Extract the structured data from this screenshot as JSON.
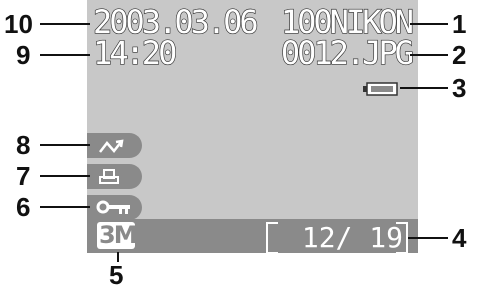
{
  "screen": {
    "date": "2003.03.06",
    "time": "14:20",
    "folder": "100NIKON",
    "file": "0012.JPG",
    "image_size": "3M",
    "frame_current": "12",
    "frame_total": "19",
    "frame_display": "12/  19"
  },
  "callouts": [
    "1",
    "2",
    "3",
    "4",
    "5",
    "6",
    "7",
    "8",
    "9",
    "10"
  ],
  "icons": [
    "transfer-icon",
    "print-icon",
    "protect-key-icon",
    "battery-icon"
  ],
  "colors": {
    "lcd_bg": "#c8c8c8",
    "bar": "#8a8a8a",
    "text": "#ffffff"
  }
}
